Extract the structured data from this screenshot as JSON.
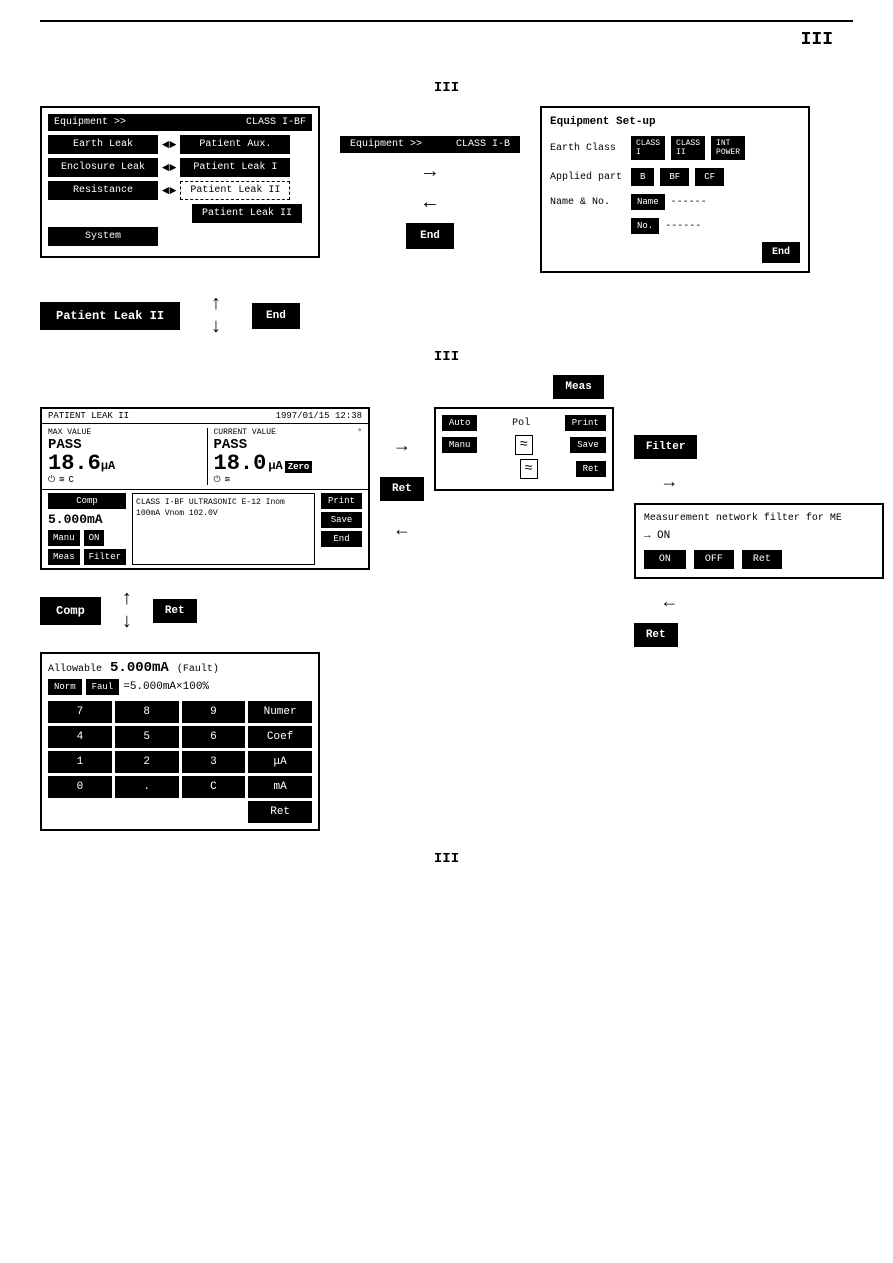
{
  "page": {
    "top_roman": "III",
    "bottom_roman": "III",
    "section_roman_1": "III",
    "section_roman_2": "III"
  },
  "menu_screen": {
    "header_left": "Equipment >>",
    "header_right": "CLASS I-BF",
    "btn_earth_leak": "Earth Leak",
    "btn_patient_aux": "Patient Aux.",
    "btn_enclosure_leak": "Enclosure Leak",
    "btn_patient_leak_i": "Patient Leak I",
    "btn_resistance": "Resistance",
    "btn_patient_leak_ii_dim": "Patient Leak II",
    "btn_patient_leak_ii": "Patient Leak II",
    "btn_system": "System"
  },
  "transport_screen": {
    "header_left": "Equipment >>",
    "header_right": "CLASS I-B"
  },
  "equip_setup": {
    "title": "Equipment Set-up",
    "earth_class_label": "Earth Class",
    "class_i_btn": "CLASS I",
    "class_ii_btn": "CLASS II",
    "int_power_btn": "INT POWER",
    "applied_part_label": "Applied part",
    "btn_b": "B",
    "btn_bf": "BF",
    "btn_cf": "CF",
    "name_no_label": "Name & No.",
    "name_btn": "Name",
    "name_dashes": "------",
    "no_btn": "No.",
    "no_dashes": "------",
    "end_btn": "End"
  },
  "action_buttons": {
    "patient_leak_ii": "Patient Leak II",
    "end": "End"
  },
  "patient_leak_screen": {
    "title": "PATIENT LEAK II",
    "datetime": "1997/01/15 12:38",
    "max_value_label": "MAX VALUE",
    "max_pass": "PASS",
    "current_value_label": "CURRENT VALUE",
    "current_pass": "PASS",
    "degree_symbol": "°",
    "value1": "18.6",
    "unit1": "μA",
    "value2": "18.0",
    "unit2": "μA",
    "zero_btn": "Zero",
    "comp_btn": "Comp",
    "comp_value": "5.000mA",
    "device_info": "CLASS I-BF ULTRASONIC E-12 Inom 100mA Vnom 102.0V",
    "print_btn": "Print",
    "save_btn": "Save",
    "end_btn": "End",
    "manu_btn": "Manu",
    "on_btn": "ON",
    "meas_btn": "Meas",
    "filter_btn": "Filter"
  },
  "meas_panel": {
    "auto_btn": "Auto",
    "pol_label": "Pol",
    "print_btn": "Print",
    "manu_btn": "Manu",
    "icon1": "≈",
    "save_btn": "Save",
    "icon2": "≈",
    "ret_btn": "Ret"
  },
  "comp_screen": {
    "allowable_label": "Allowable",
    "value": "5.000mA",
    "fault_label": "(Fault)",
    "norm_btn": "Norm",
    "faul_btn": "Faul",
    "formula": "=5.000mA×100%",
    "btn_7": "7",
    "btn_8": "8",
    "btn_9": "9",
    "numer_btn": "Numer",
    "btn_4": "4",
    "btn_5": "5",
    "btn_6": "6",
    "coef_btn": "Coef",
    "btn_1": "1",
    "btn_2": "2",
    "btn_3": "3",
    "ua_btn": "μA",
    "btn_0": "0",
    "dot_btn": ".",
    "c_btn": "C",
    "ma_btn": "mA",
    "ret_btn": "Ret"
  },
  "filter_screen": {
    "title": "Measurement network filter for ME",
    "arrow_on": "→ ON",
    "on_btn": "ON",
    "off_btn": "OFF",
    "ret_btn": "Ret"
  },
  "flow_labels": {
    "meas": "Meas",
    "ret": "Ret",
    "ret2": "Ret",
    "filter": "Filter",
    "comp": "Comp"
  }
}
